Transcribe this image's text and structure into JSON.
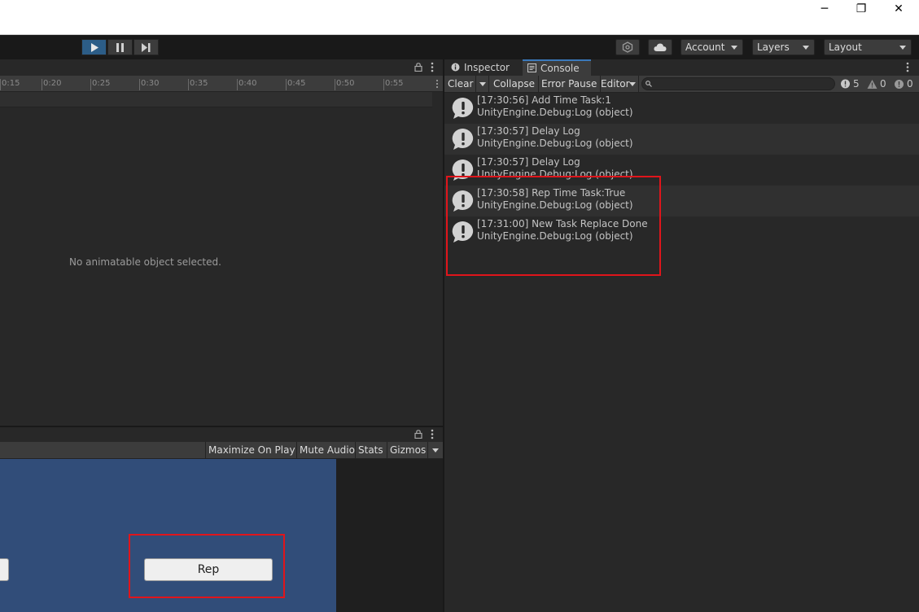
{
  "window": {
    "min_glyph": "─",
    "max_glyph": "❐",
    "close_glyph": "✕"
  },
  "toolbar": {
    "play_icon": "play-icon",
    "pause_icon": "pause-icon",
    "step_icon": "step-icon",
    "collab_icon": "collab-icon",
    "cloud_icon": "cloud-icon",
    "account_label": "Account",
    "layers_label": "Layers",
    "layout_label": "Layout",
    "accent_color": "#2c5d87"
  },
  "animation": {
    "ticks": [
      "0:15",
      "0:20",
      "0:25",
      "0:30",
      "0:35",
      "0:40",
      "0:45",
      "0:50",
      "0:55"
    ],
    "empty_message": "No animatable object selected."
  },
  "game": {
    "maximize_label": "Maximize On Play",
    "mute_label": "Mute Audio",
    "stats_label": "Stats",
    "gizmos_label": "Gizmos",
    "rep_button_label": "Rep",
    "canvas_color": "#314d79"
  },
  "console": {
    "tabs": [
      {
        "label": "Inspector",
        "icon": "info-icon"
      },
      {
        "label": "Console",
        "icon": "console-icon"
      }
    ],
    "toolbar": {
      "clear_label": "Clear",
      "collapse_label": "Collapse",
      "error_pause_label": "Error Pause",
      "editor_label": "Editor"
    },
    "counts": {
      "logs": "5",
      "warnings": "0",
      "errors": "0"
    },
    "entries": [
      {
        "line1": "[17:30:56] Add Time Task:1",
        "line2": "UnityEngine.Debug:Log (object)"
      },
      {
        "line1": "[17:30:57] Delay Log",
        "line2": "UnityEngine.Debug:Log (object)"
      },
      {
        "line1": "[17:30:57] Delay Log",
        "line2": "UnityEngine.Debug:Log (object)"
      },
      {
        "line1": "[17:30:58] Rep Time Task:True",
        "line2": "UnityEngine.Debug:Log (object)"
      },
      {
        "line1": "[17:31:00] New Task Replace Done",
        "line2": "UnityEngine.Debug:Log (object)"
      }
    ]
  },
  "highlight_color": "#e0151b"
}
